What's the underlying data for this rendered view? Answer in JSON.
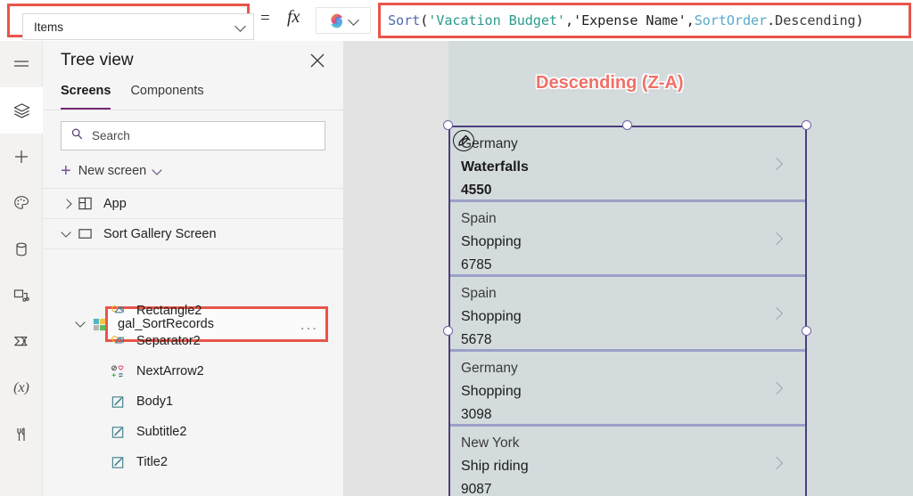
{
  "topbar": {
    "property_selector": {
      "value": "Items",
      "icon": "chevron-down-icon"
    },
    "equals": "=",
    "fx": "fx",
    "copilot": {
      "icon": "copilot-icon",
      "chevron": "chevron-down-icon"
    },
    "formula": {
      "full_text": "Sort('Vacation Budget','Expense Name',SortOrder.Descending)",
      "tokens": [
        {
          "text": "Sort",
          "kind": "function"
        },
        {
          "text": "(",
          "kind": "punct"
        },
        {
          "text": "'Vacation Budget'",
          "kind": "string"
        },
        {
          "text": ",",
          "kind": "punct"
        },
        {
          "text": "'Expense Name'",
          "kind": "string-plain"
        },
        {
          "text": ",",
          "kind": "punct"
        },
        {
          "text": "SortOrder",
          "kind": "enum"
        },
        {
          "text": ".",
          "kind": "punct"
        },
        {
          "text": "Descending",
          "kind": "member"
        },
        {
          "text": ")",
          "kind": "punct"
        }
      ]
    }
  },
  "rail": {
    "items": [
      {
        "icon": "hamburger-menu-icon",
        "name": "menu",
        "active": false
      },
      {
        "icon": "layers-icon",
        "name": "tree-view",
        "active": true
      },
      {
        "icon": "plus-icon",
        "name": "insert",
        "active": false
      },
      {
        "icon": "palette-icon",
        "name": "theme",
        "active": false
      },
      {
        "icon": "database-icon",
        "name": "data",
        "active": false
      },
      {
        "icon": "media-icon",
        "name": "media",
        "active": false
      },
      {
        "icon": "power-automate-icon",
        "name": "power-automate",
        "active": false
      },
      {
        "icon": "variables-icon",
        "name": "variables",
        "label": "(x)",
        "active": false
      },
      {
        "icon": "tools-icon",
        "name": "advanced-tools",
        "active": false
      }
    ]
  },
  "tree": {
    "title": "Tree view",
    "close_icon": "close-icon",
    "tabs": [
      {
        "label": "Screens",
        "active": true
      },
      {
        "label": "Components",
        "active": false
      }
    ],
    "search": {
      "placeholder": "Search",
      "icon": "search-icon",
      "value": ""
    },
    "new_screen": {
      "label": "New screen",
      "plus_icon": "plus-icon",
      "chevron": "chevron-down-icon"
    },
    "nodes": [
      {
        "label": "App",
        "icon": "app-grid-icon",
        "expand": "collapsed",
        "indent": 0
      },
      {
        "label": "Sort Gallery Screen",
        "icon": "screen-icon",
        "expand": "expanded",
        "indent": 0
      },
      {
        "label": "gal_SortRecords",
        "icon": "gallery-icon",
        "expand": "expanded",
        "indent": 1,
        "highlighted": true,
        "overflow": "..."
      },
      {
        "label": "Rectangle2",
        "icon": "shape-icon",
        "expand": "none",
        "indent": 2
      },
      {
        "label": "Separator2",
        "icon": "shape-icon",
        "expand": "none",
        "indent": 2
      },
      {
        "label": "NextArrow2",
        "icon": "icon-set-icon",
        "expand": "none",
        "indent": 2
      },
      {
        "label": "Body1",
        "icon": "label-icon",
        "expand": "none",
        "indent": 2
      },
      {
        "label": "Subtitle2",
        "icon": "label-icon",
        "expand": "none",
        "indent": 2
      },
      {
        "label": "Title2",
        "icon": "label-icon",
        "expand": "none",
        "indent": 2
      }
    ]
  },
  "canvas": {
    "annotation": "Descending (Z-A)",
    "gallery_name": "gal_SortRecords",
    "items": [
      {
        "title": "Germany",
        "subtitle": "Waterfalls",
        "body": "4550",
        "chevron": "chevron-right-icon",
        "selected": true
      },
      {
        "title": "Spain",
        "subtitle": "Shopping",
        "body": "6785",
        "chevron": "chevron-right-icon",
        "selected": false
      },
      {
        "title": "Spain",
        "subtitle": "Shopping",
        "body": "5678",
        "chevron": "chevron-right-icon",
        "selected": false
      },
      {
        "title": "Germany",
        "subtitle": "Shopping",
        "body": "3098",
        "chevron": "chevron-right-icon",
        "selected": false
      },
      {
        "title": "New York",
        "subtitle": "Ship riding",
        "body": "9087",
        "chevron": "chevron-right-icon",
        "selected": false
      }
    ]
  },
  "colors": {
    "accent_purple": "#742774",
    "annotation_red": "#f07068",
    "highlight_box": "#e8554a",
    "selection_border": "#4b3f7c",
    "gallery_bg": "#d4dbdd"
  }
}
